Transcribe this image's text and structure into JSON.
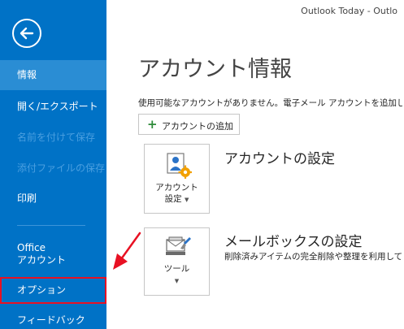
{
  "window": {
    "title": "Outlook Today - Outlo"
  },
  "sidebar": {
    "items": [
      {
        "label": "情報"
      },
      {
        "label": "開く/エクスポート"
      },
      {
        "label": "名前を付けて保存"
      },
      {
        "label": "添付ファイルの保存"
      },
      {
        "label": "印刷"
      },
      {
        "label_line1": "Office",
        "label_line2": "アカウント"
      },
      {
        "label": "オプション"
      },
      {
        "label": "フィードバック"
      }
    ]
  },
  "main": {
    "page_title": "アカウント情報",
    "info_text": "使用可能なアカウントがありません。電子メール アカウントを追加して、",
    "add_account_label": "アカウントの追加",
    "sections": [
      {
        "tile_line1": "アカウント",
        "tile_line2": "設定",
        "title": "アカウントの設定",
        "description": ""
      },
      {
        "tile_line1": "ツール",
        "title": "メールボックスの設定",
        "description": "削除済みアイテムの完全削除や整理を利用して"
      }
    ]
  },
  "colors": {
    "sidebar": "#0072c6",
    "active_item": "#2a8dd4",
    "annotation_red": "#e81123"
  }
}
